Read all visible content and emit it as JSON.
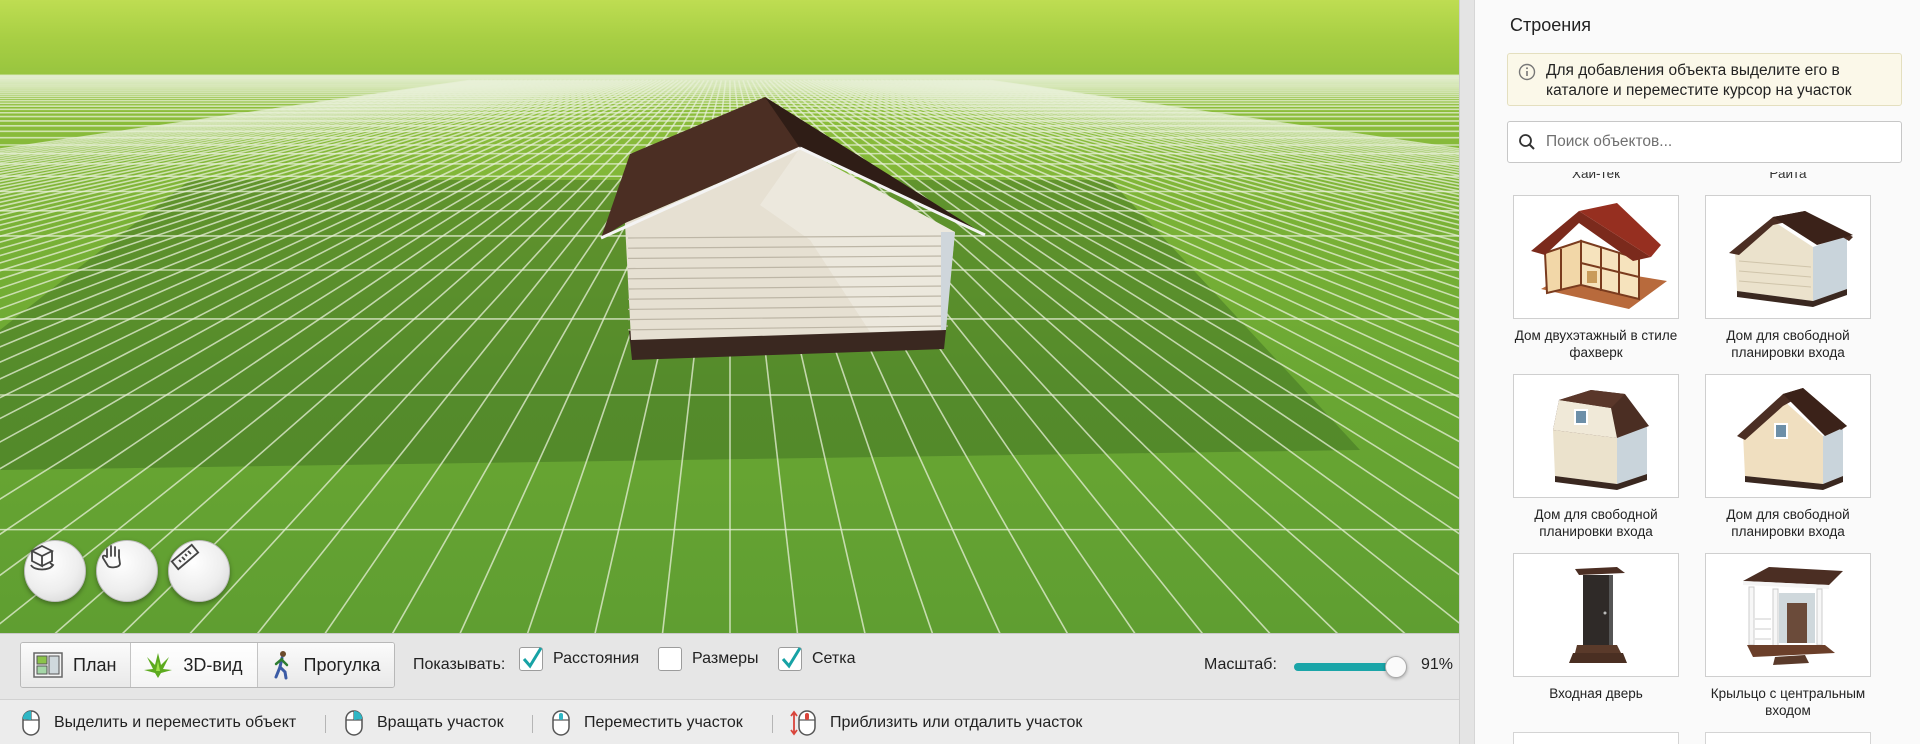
{
  "viewport": {
    "nav_buttons": [
      {
        "name": "rotate-view-button",
        "icon": "rotate-3d-icon"
      },
      {
        "name": "pan-view-button",
        "icon": "hand-icon"
      },
      {
        "name": "measure-button",
        "icon": "ruler-icon"
      }
    ]
  },
  "toolbar": {
    "views": [
      {
        "label": "План",
        "icon": "plan-icon"
      },
      {
        "label": "3D-вид",
        "icon": "3d-view-icon",
        "active": true
      },
      {
        "label": "Прогулка",
        "icon": "walk-icon"
      }
    ],
    "show_label": "Показывать:",
    "checkboxes": [
      {
        "label": "Расстояния",
        "checked": true
      },
      {
        "label": "Размеры",
        "checked": false
      },
      {
        "label": "Сетка",
        "checked": true
      }
    ],
    "scale_label": "Масштаб:",
    "scale_value": "91%",
    "scale_fraction": 0.91,
    "accent_color": "#1aa5a8"
  },
  "statusbar": {
    "hints": [
      {
        "label": "Выделить и переместить объект",
        "icon": "mouse-left-icon"
      },
      {
        "label": "Вращать участок",
        "icon": "mouse-right-icon"
      },
      {
        "label": "Переместить участок",
        "icon": "mouse-middle-icon"
      },
      {
        "label": "Приблизить или отдалить участок",
        "icon": "mouse-scroll-icon"
      }
    ]
  },
  "panel": {
    "title": "Строения",
    "info_text": "Для добавления объекта выделите его в каталоге и переместите курсор на участок",
    "search_placeholder": "Поиск объектов...",
    "cut_labels": [
      "Хай-тек",
      "Райта"
    ],
    "items": [
      {
        "label": "Дом двухэтажный в стиле фахверк",
        "thumb": "fachwerk-house"
      },
      {
        "label": "Дом для свободной планировки входа",
        "thumb": "gable-house"
      },
      {
        "label": "Дом для свободной планировки входа",
        "thumb": "mansard-house"
      },
      {
        "label": "Дом для свободной планировки входа",
        "thumb": "gable-window-house"
      },
      {
        "label": "Входная дверь",
        "thumb": "entrance-door"
      },
      {
        "label": "Крыльцо с центральным входом",
        "thumb": "porch"
      }
    ]
  }
}
